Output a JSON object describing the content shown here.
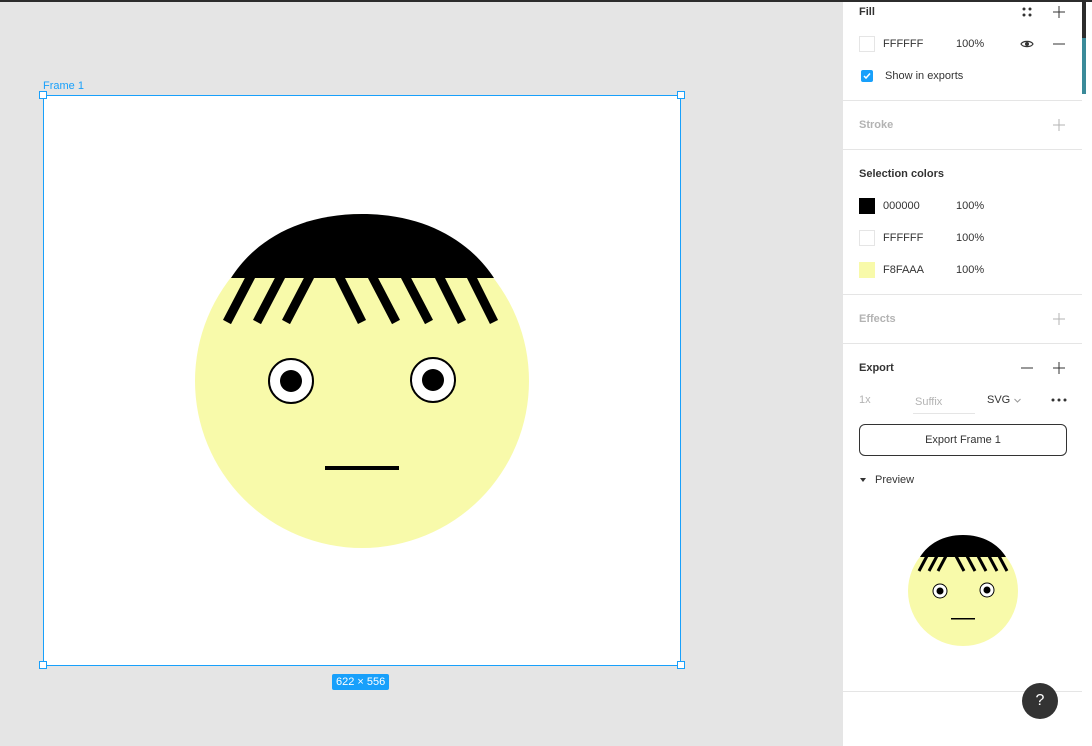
{
  "canvas": {
    "frame_label": "Frame 1",
    "size_badge": "622 × 556"
  },
  "panel": {
    "fill": {
      "title": "Fill",
      "hex": "FFFFFF",
      "opacity": "100%",
      "show_in_exports": "Show in exports",
      "show_in_exports_checked": true
    },
    "stroke": {
      "title": "Stroke"
    },
    "selection_colors": {
      "title": "Selection colors",
      "items": [
        {
          "hex": "000000",
          "opacity": "100%",
          "color": "#000000"
        },
        {
          "hex": "FFFFFF",
          "opacity": "100%",
          "color": "#FFFFFF"
        },
        {
          "hex": "F8FAAA",
          "opacity": "100%",
          "color": "#F8FAAA"
        }
      ]
    },
    "effects": {
      "title": "Effects"
    },
    "export": {
      "title": "Export",
      "scale": "1x",
      "suffix_placeholder": "Suffix",
      "format": "SVG",
      "button_label": "Export Frame 1",
      "preview_label": "Preview"
    }
  },
  "help_label": "?",
  "colors": {
    "accent": "#18a0fb",
    "face": "#F8FAAA",
    "hair": "#000000",
    "canvas_bg": "#e5e5e5"
  }
}
